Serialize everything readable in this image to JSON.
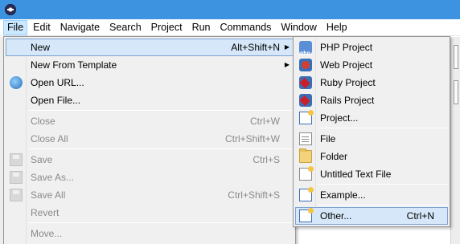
{
  "menubar": {
    "items": [
      "File",
      "Edit",
      "Navigate",
      "Search",
      "Project",
      "Run",
      "Commands",
      "Window",
      "Help"
    ],
    "active": "File"
  },
  "file_menu": {
    "items": [
      {
        "label": "New",
        "accel": "Alt+Shift+N",
        "arrow": "▶",
        "state": "highlighted"
      },
      {
        "label": "New From Template",
        "accel": "",
        "arrow": "▶",
        "state": "enabled"
      },
      {
        "label": "Open URL...",
        "accel": "",
        "icon": "globe-icon",
        "state": "enabled"
      },
      {
        "label": "Open File...",
        "accel": "",
        "state": "enabled"
      },
      {
        "label": "Close",
        "accel": "Ctrl+W",
        "state": "disabled"
      },
      {
        "label": "Close All",
        "accel": "Ctrl+Shift+W",
        "state": "disabled"
      },
      {
        "label": "Save",
        "accel": "Ctrl+S",
        "icon": "save-icon",
        "state": "disabled"
      },
      {
        "label": "Save As...",
        "accel": "",
        "icon": "save-as-icon",
        "state": "disabled"
      },
      {
        "label": "Save All",
        "accel": "Ctrl+Shift+S",
        "icon": "save-all-icon",
        "state": "disabled"
      },
      {
        "label": "Revert",
        "accel": "",
        "state": "disabled"
      },
      {
        "label": "Move...",
        "accel": "",
        "state": "disabled"
      }
    ]
  },
  "new_menu": {
    "items": [
      {
        "label": "PHP Project",
        "accel": "",
        "icon": "php-project-icon"
      },
      {
        "label": "Web Project",
        "accel": "",
        "icon": "web-project-icon"
      },
      {
        "label": "Ruby Project",
        "accel": "",
        "icon": "ruby-project-icon"
      },
      {
        "label": "Rails Project",
        "accel": "",
        "icon": "rails-project-icon"
      },
      {
        "label": "Project...",
        "accel": "",
        "icon": "new-project-icon"
      },
      {
        "label": "File",
        "accel": "",
        "icon": "file-icon"
      },
      {
        "label": "Folder",
        "accel": "",
        "icon": "folder-icon"
      },
      {
        "label": "Untitled Text File",
        "accel": "",
        "icon": "text-file-icon"
      },
      {
        "label": "Example...",
        "accel": "",
        "icon": "example-icon"
      },
      {
        "label": "Other...",
        "accel": "Ctrl+N",
        "icon": "other-wizard-icon",
        "state": "highlighted"
      }
    ],
    "php_badge": "php"
  },
  "colors": {
    "titlebar": "#3d93e0",
    "highlight_bg": "#d5e7f8",
    "highlight_border": "#7da2ce",
    "menubar_active_bg": "#cce8ff",
    "disabled_text": "#8a8a8a"
  }
}
